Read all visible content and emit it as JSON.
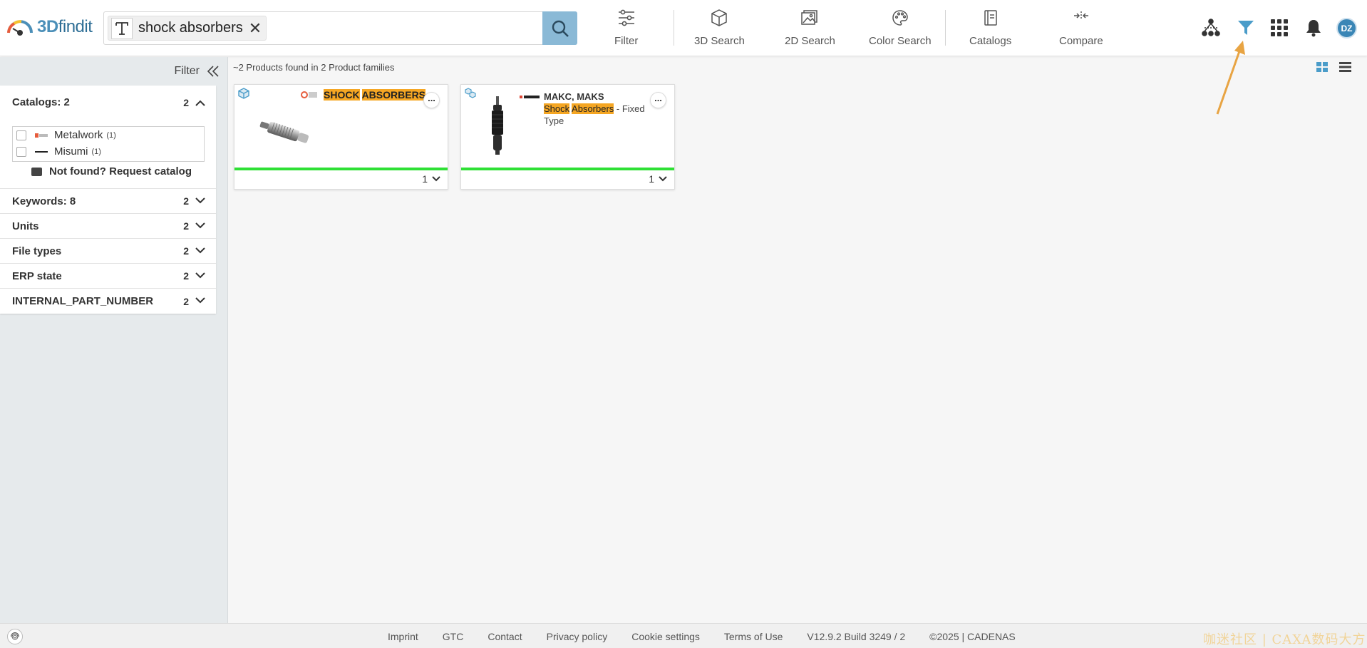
{
  "header": {
    "logo": {
      "prefix": "3D",
      "suffix": "findit"
    },
    "search": {
      "query": "shock absorbers"
    },
    "nav": [
      {
        "label": "Filter",
        "icon": "sliders-icon"
      },
      {
        "label": "3D Search",
        "icon": "cube-icon"
      },
      {
        "label": "2D Search",
        "icon": "image-icon"
      },
      {
        "label": "Color Search",
        "icon": "palette-icon"
      },
      {
        "label": "Catalogs",
        "icon": "book-icon"
      },
      {
        "label": "Compare",
        "icon": "compare-arrows-icon"
      }
    ],
    "right_icons": [
      "network-icon",
      "filter-funnel-icon",
      "apps-grid-icon",
      "bell-icon"
    ],
    "avatar_initials": "DZ",
    "accent_color": "#3a86b6",
    "active_filter_color": "#4a9cc9"
  },
  "sidebar": {
    "title": "Filter",
    "catalogs": {
      "title": "Catalogs: 2",
      "count": "2",
      "items": [
        {
          "label": "Metalwork",
          "count": "(1)"
        },
        {
          "label": "Misumi",
          "count": "(1)"
        }
      ],
      "request_label": "Not found? Request catalog"
    },
    "sections": [
      {
        "label": "Keywords: 8",
        "count": "2"
      },
      {
        "label": "Units",
        "count": "2"
      },
      {
        "label": "File types",
        "count": "2"
      },
      {
        "label": "ERP state",
        "count": "2"
      },
      {
        "label": "INTERNAL_PART_NUMBER",
        "count": "2"
      }
    ]
  },
  "main": {
    "result_count": "~2 Products found in 2 Product families",
    "cards": [
      {
        "title_parts": [
          "SHOCK",
          "ABSORBERS"
        ],
        "qty": "1"
      },
      {
        "name": "MAKC, MAKS",
        "title_hl1": "Shock",
        "title_hl2": "Absorbers",
        "title_rest": " - Fixed Type",
        "qty": "1"
      }
    ]
  },
  "footer": {
    "links": [
      "Imprint",
      "GTC",
      "Contact",
      "Privacy policy",
      "Cookie settings",
      "Terms of Use"
    ],
    "version": "V12.9.2 Build 3249 / 2",
    "copyright": "©2025 | CADENAS",
    "watermark": "咖迷社区 | CAXA数码大方"
  },
  "colors": {
    "highlight": "#f5a623",
    "status_bar": "#2fe035",
    "annotation_arrow": "#e8a443"
  }
}
